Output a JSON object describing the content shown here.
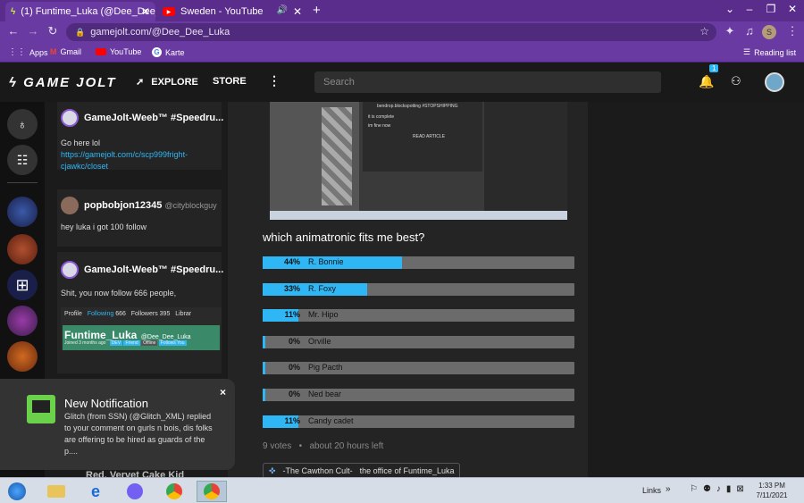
{
  "browser": {
    "tabs": [
      {
        "title": "(1) Funtime_Luka (@Dee_Dee_Lu",
        "close": "✕"
      },
      {
        "title": "Sweden - YouTube",
        "close": "✕"
      }
    ],
    "new_tab": "+",
    "url": "gamejolt.com/@Dee_Dee_Luka",
    "profile_letter": "S",
    "bookmarks": [
      "Apps",
      "Gmail",
      "YouTube",
      "Karte"
    ],
    "reading_list": "Reading list"
  },
  "gamejolt": {
    "logo": "GAME JOLT",
    "nav": {
      "explore": "EXPLORE",
      "store": "STORE"
    },
    "search_placeholder": "Search",
    "notif_count": "1"
  },
  "feed": {
    "posts": [
      {
        "author": "GameJolt-Weeb™ #Speedru...",
        "text": "Go here lol",
        "link": "https://gamejolt.com/c/scp999fright-cjawkc/closet"
      },
      {
        "author": "popbobjon12345",
        "handle": "@cityblockguy",
        "text": "hey luka i got 100 follow"
      },
      {
        "author": "GameJolt-Weeb™ #Speedru...",
        "text": "Shit, you now follow 666 people,"
      }
    ],
    "profile_card": {
      "tabs": [
        "Profile",
        "Following",
        "666",
        "Followers",
        "395",
        "Librar"
      ],
      "name": "Funtime_Luka",
      "handle": "@Dee_Dee_Luka",
      "joined": "Joined 3 months ago",
      "badges": [
        "DEV",
        "Friend",
        "Offline",
        "Follows You"
      ]
    },
    "last_author": "Red, Vervet Cake Kid"
  },
  "main": {
    "poll_question": "which animatronic fits me best?",
    "options": [
      {
        "pct_label": "44%",
        "label": "R. Bonnie",
        "pct": 44
      },
      {
        "pct_label": "33%",
        "label": "R. Foxy",
        "pct": 33
      },
      {
        "pct_label": "11%",
        "label": "Mr. Hipo",
        "pct": 11
      },
      {
        "pct_label": "0%",
        "label": "Orville",
        "pct": 0
      },
      {
        "pct_label": "0%",
        "label": "Pig Pacth",
        "pct": 0
      },
      {
        "pct_label": "0%",
        "label": "Ned bear",
        "pct": 0
      },
      {
        "pct_label": "11%",
        "label": "Candy cadet",
        "pct": 11
      }
    ],
    "votes": "9 votes",
    "time_left": "about 20 hours left",
    "community_tag": "-The Cawthon Cult-",
    "channel_tag": "the office of Funtime_Luka",
    "embed": {
      "title": "bendrop.blockspotting #STOPSHIPPING",
      "line1": "it is complete",
      "line2": "im fine now",
      "read": "READ ARTICLE"
    }
  },
  "notification": {
    "title": "New Notification",
    "body": "Glitch (from SSN) (@Glitch_XML) replied to your comment on gurls n bois, dis folks are offering to be hired as guards of the p....",
    "close": "×"
  },
  "taskbar": {
    "links": "Links",
    "time": "1:33 PM",
    "date": "7/11/2021"
  },
  "colors": {
    "accent": "#2fb7f5",
    "chrome": "#6a3aa3"
  }
}
